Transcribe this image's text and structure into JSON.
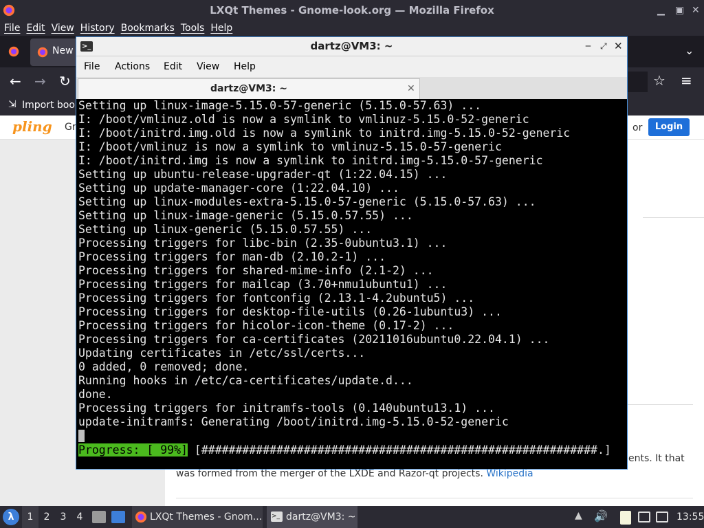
{
  "firefox": {
    "window_title": "LXQt Themes - Gnome-look.org — Mozilla Firefox",
    "menu": [
      "File",
      "Edit",
      "View",
      "History",
      "Bookmarks",
      "Tools",
      "Help"
    ],
    "tab_label": "New",
    "bookmark_label": "Import book",
    "content": {
      "logo_text": "pling",
      "nav_text": "Gr",
      "or_text": "or",
      "login_label": "Login",
      "body_text_1": "ents. It that",
      "body_text_2": "was formed from the merger of the LXDE and Razor-qt projects.",
      "link_text": "Wikipedia"
    }
  },
  "terminal": {
    "title": "dartz@VM3: ~",
    "tab_title": "dartz@VM3: ~",
    "menu": [
      "File",
      "Actions",
      "Edit",
      "View",
      "Help"
    ],
    "lines": [
      "Setting up linux-image-5.15.0-57-generic (5.15.0-57.63) ...",
      "I: /boot/vmlinuz.old is now a symlink to vmlinuz-5.15.0-52-generic",
      "I: /boot/initrd.img.old is now a symlink to initrd.img-5.15.0-52-generic",
      "I: /boot/vmlinuz is now a symlink to vmlinuz-5.15.0-57-generic",
      "I: /boot/initrd.img is now a symlink to initrd.img-5.15.0-57-generic",
      "Setting up ubuntu-release-upgrader-qt (1:22.04.15) ...",
      "Setting up update-manager-core (1:22.04.10) ...",
      "Setting up linux-modules-extra-5.15.0-57-generic (5.15.0-57.63) ...",
      "Setting up linux-image-generic (5.15.0.57.55) ...",
      "Setting up linux-generic (5.15.0.57.55) ...",
      "Processing triggers for libc-bin (2.35-0ubuntu3.1) ...",
      "Processing triggers for man-db (2.10.2-1) ...",
      "Processing triggers for shared-mime-info (2.1-2) ...",
      "Processing triggers for mailcap (3.70+nmu1ubuntu1) ...",
      "Processing triggers for fontconfig (2.13.1-4.2ubuntu5) ...",
      "Processing triggers for desktop-file-utils (0.26-1ubuntu3) ...",
      "Processing triggers for hicolor-icon-theme (0.17-2) ...",
      "Processing triggers for ca-certificates (20211016ubuntu0.22.04.1) ...",
      "Updating certificates in /etc/ssl/certs...",
      "0 added, 0 removed; done.",
      "Running hooks in /etc/ca-certificates/update.d...",
      "done.",
      "Processing triggers for initramfs-tools (0.140ubuntu13.1) ...",
      "update-initramfs: Generating /boot/initrd.img-5.15.0-52-generic"
    ],
    "progress_label": "Progress: [ 99%]",
    "progress_bar": " [##########################################################.]",
    "progress_percent": 99
  },
  "taskbar": {
    "desktops": [
      "1",
      "2",
      "3",
      "4"
    ],
    "firefox_task": "LXQt Themes - Gnom...",
    "terminal_task": "dartz@VM3: ~",
    "clock": "13:55"
  },
  "colors": {
    "accent_blue": "#4a90d9",
    "progress_green": "#4bba1e",
    "login_blue": "#1e6fd9",
    "link_blue": "#2a74c8"
  }
}
